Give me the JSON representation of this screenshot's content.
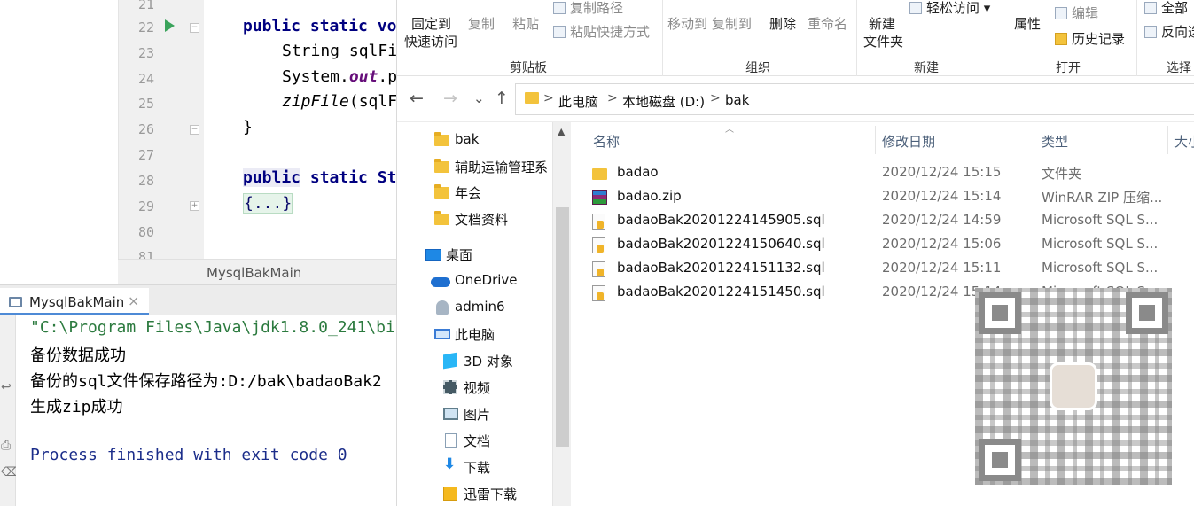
{
  "ide": {
    "line_numbers": [
      "21",
      "22",
      "23",
      "24",
      "25",
      "26",
      "27",
      "28",
      "29",
      "80",
      "81"
    ],
    "code": {
      "l22_kw": "public static",
      "l22_rest": " vo",
      "l23": "String sqlFi",
      "l24_pre": "System.",
      "l24_field": "out",
      "l24_post": ".p",
      "l25_call": "zipFile",
      "l25_post": "(sqlF",
      "l26": "}",
      "l28_kw1": "public",
      "l28_kw2": "static",
      "l28_rest": " St",
      "l29_fold": "{...}"
    },
    "editor_tab": "MysqlBakMain",
    "run_tab": {
      "label": "MysqlBakMain",
      "close": "×"
    },
    "console": {
      "cmd": "\"C:\\Program Files\\Java\\jdk1.8.0_241\\bi",
      "out1": "备份数据成功",
      "out2": "备份的sql文件保存路径为:D:/bak\\badaoBak2",
      "out3": "生成zip成功",
      "exit": "Process finished with exit code 0"
    }
  },
  "explorer": {
    "ribbon": {
      "pin_line1": "固定到",
      "pin_line2": "快速访问",
      "copy": "复制",
      "paste": "粘贴",
      "copy_path": "复制路径",
      "paste_shortcut": "粘贴快捷方式",
      "move_to": "移动到",
      "copy_to": "复制到",
      "delete": "删除",
      "rename": "重命名",
      "new_folder_line1": "新建",
      "new_folder_line2": "文件夹",
      "easy_access": "轻松访问",
      "properties": "属性",
      "edit": "编辑",
      "history": "历史记录",
      "select_all": "全部",
      "invert": "反向选",
      "group_clipboard": "剪贴板",
      "group_organize": "组织",
      "group_new": "新建",
      "group_open": "打开",
      "group_select": "选择"
    },
    "nav_buttons": {
      "back": "←",
      "forward": "→",
      "recent": "⌄",
      "up": "↑"
    },
    "breadcrumb": [
      "此电脑",
      "本地磁盘 (D:)",
      "bak"
    ],
    "breadcrumb_sep": ">",
    "tree": [
      {
        "label": "bak",
        "icon": "folder-icon"
      },
      {
        "label": "辅助运输管理系",
        "icon": "folder-icon"
      },
      {
        "label": "年会",
        "icon": "folder-icon"
      },
      {
        "label": "文档资料",
        "icon": "folder-icon"
      },
      {
        "label": "桌面",
        "icon": "desktop-icon"
      },
      {
        "label": "OneDrive",
        "icon": "onedrive-icon"
      },
      {
        "label": "admin6",
        "icon": "user-icon"
      },
      {
        "label": "此电脑",
        "icon": "this-pc-icon"
      },
      {
        "label": "3D 对象",
        "icon": "3d-objects-icon"
      },
      {
        "label": "视频",
        "icon": "videos-icon"
      },
      {
        "label": "图片",
        "icon": "pictures-icon"
      },
      {
        "label": "文档",
        "icon": "documents-icon"
      },
      {
        "label": "下载",
        "icon": "downloads-icon"
      },
      {
        "label": "迅雷下载",
        "icon": "thunder-download-icon"
      }
    ],
    "columns": {
      "name": "名称",
      "date": "修改日期",
      "type": "类型",
      "size": "大小"
    },
    "files": [
      {
        "name": "badao",
        "date": "2020/12/24 15:15",
        "type": "文件夹",
        "icon": "folder-icon"
      },
      {
        "name": "badao.zip",
        "date": "2020/12/24 15:14",
        "type": "WinRAR ZIP 压缩...",
        "icon": "zip-icon"
      },
      {
        "name": "badaoBak20201224145905.sql",
        "date": "2020/12/24 14:59",
        "type": "Microsoft SQL S...",
        "icon": "sql-file-icon"
      },
      {
        "name": "badaoBak20201224150640.sql",
        "date": "2020/12/24 15:06",
        "type": "Microsoft SQL S...",
        "icon": "sql-file-icon"
      },
      {
        "name": "badaoBak20201224151132.sql",
        "date": "2020/12/24 15:11",
        "type": "Microsoft SQL S...",
        "icon": "sql-file-icon"
      },
      {
        "name": "badaoBak20201224151450.sql",
        "date": "2020/12/24 15:14",
        "type": "Microsoft SQL S...",
        "icon": "sql-file-icon"
      }
    ]
  },
  "colors": {
    "folder": "#f3c33c",
    "accent": "#4d8ad6",
    "keyword": "#000080",
    "console_path": "#2b7a3e"
  }
}
